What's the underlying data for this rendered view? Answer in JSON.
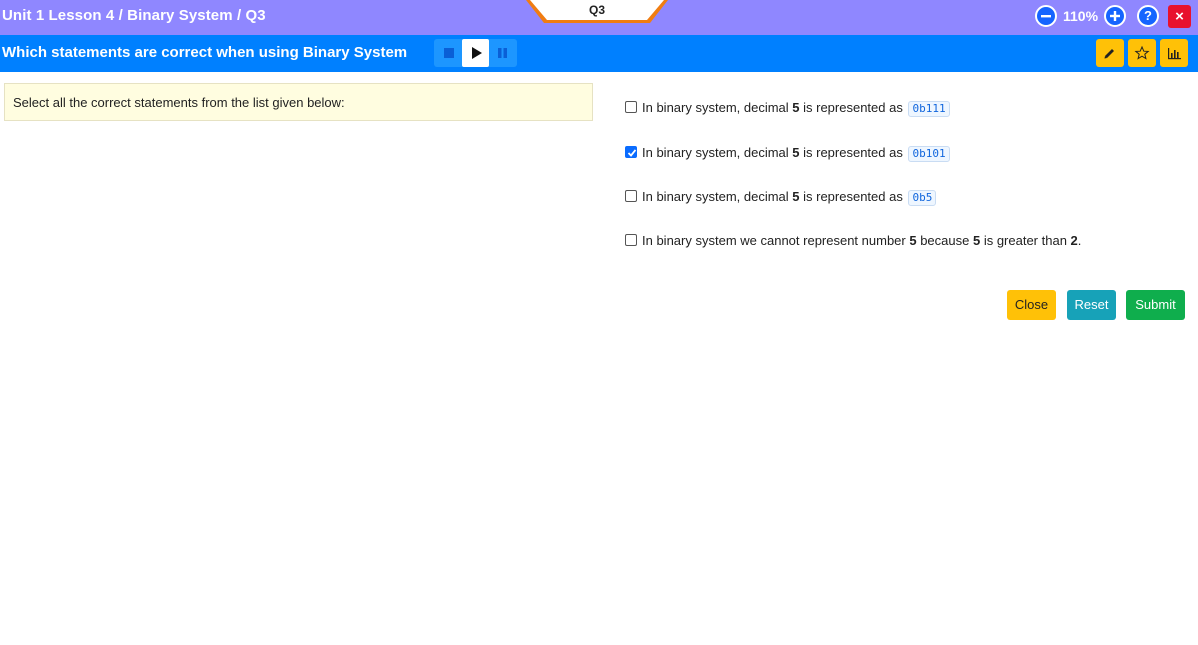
{
  "header": {
    "breadcrumb": "Unit 1 Lesson 4 / Binary System / Q3",
    "question_tab": "Q3",
    "zoom_level": "110%",
    "help_label": "?",
    "close_label": "×"
  },
  "titlebar": {
    "title": "Which statements are correct when using Binary System"
  },
  "prompt": {
    "text": "Select all the correct statements from the list given below:"
  },
  "options": [
    {
      "prefix": "In binary system, decimal ",
      "bold": "5",
      "middle": " is represented as ",
      "code": "0b111",
      "checked": false
    },
    {
      "prefix": "In binary system, decimal ",
      "bold": "5",
      "middle": " is represented as ",
      "code": "0b101",
      "checked": true
    },
    {
      "prefix": "In binary system, decimal ",
      "bold": "5",
      "middle": " is represented as ",
      "code": "0b5",
      "checked": false
    },
    {
      "prefix": "In binary system we cannot represent number ",
      "bold": "5",
      "middle": " because ",
      "bold2": "5",
      "suffix": " is greater than ",
      "bold3": "2",
      "end": ".",
      "checked": false
    }
  ],
  "actions": {
    "close_label": "Close",
    "reset_label": "Reset",
    "submit_label": "Submit"
  },
  "colors": {
    "topbar": "#8f87ff",
    "titlebar": "#0080ff",
    "warning": "#ffc107",
    "info": "#17a2b8",
    "success": "#0fae4d",
    "danger": "#e8112d"
  },
  "icons": {
    "zoom_out": "minus-circle-icon",
    "zoom_in": "plus-circle-icon",
    "help": "question-circle-icon",
    "close": "close-icon",
    "stop": "stop-icon",
    "play": "play-icon",
    "pause": "pause-icon",
    "pencil": "pencil-icon",
    "star": "star-icon",
    "chart": "bar-chart-icon"
  }
}
